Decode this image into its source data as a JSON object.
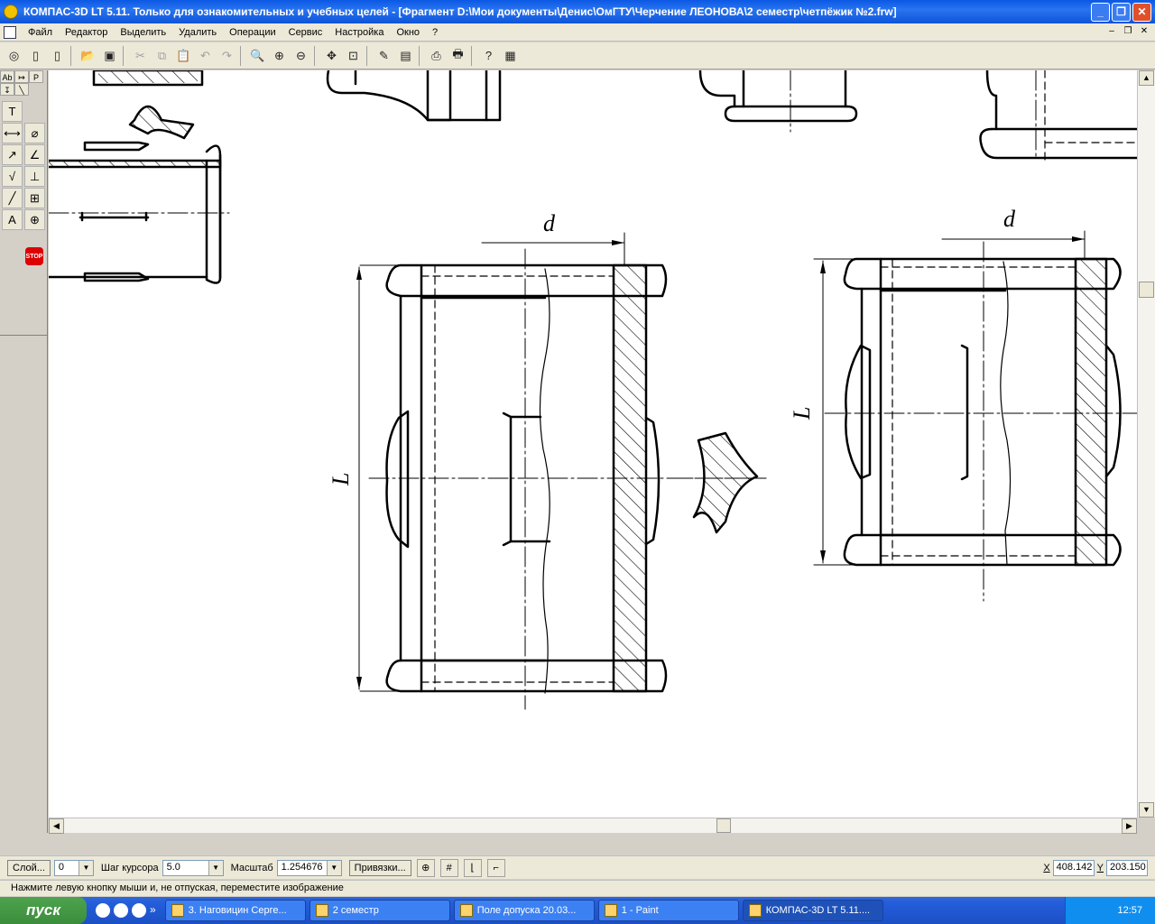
{
  "window": {
    "title": "КОМПАС-3D LT 5.11. Только для ознакомительных и учебных целей - [Фрагмент D:\\Мои документы\\Денис\\ОмГТУ\\Черчение ЛЕОНОВА\\2 семестр\\четпёжик №2.frw]",
    "minimize": "_",
    "maximize": "❐",
    "close": "✕"
  },
  "menu": {
    "items": [
      "Файл",
      "Редактор",
      "Выделить",
      "Удалить",
      "Операции",
      "Сервис",
      "Настройка",
      "Окно",
      "?"
    ]
  },
  "left_panel": {
    "tabs": [
      "Ab",
      "↦",
      "P",
      "↧",
      "╲"
    ],
    "stop_label": "STOP"
  },
  "drawing": {
    "dim_label_d": "d",
    "dim_label_L": "L"
  },
  "propbar": {
    "layer_button": "Слой...",
    "layer_value": "0",
    "step_label": "Шаг курсора",
    "step_value": "5.0",
    "scale_label": "Масштаб",
    "scale_value": "1.254676",
    "snap_button": "Привязки...",
    "x_label": "X",
    "x_value": "408.142",
    "y_label": "Y",
    "y_value": "203.150"
  },
  "hint": "Нажмите левую кнопку мыши и, не отпуская, переместите изображение",
  "taskbar": {
    "start": "пуск",
    "tasks": [
      {
        "label": "3. Наговицин Серге...",
        "active": false
      },
      {
        "label": "2 семестр",
        "active": false
      },
      {
        "label": "Поле допуска 20.03...",
        "active": false
      },
      {
        "label": "1 - Paint",
        "active": false
      },
      {
        "label": "КОМПАС-3D LT 5.11....",
        "active": true
      }
    ],
    "clock": "12:57",
    "more": "»"
  }
}
